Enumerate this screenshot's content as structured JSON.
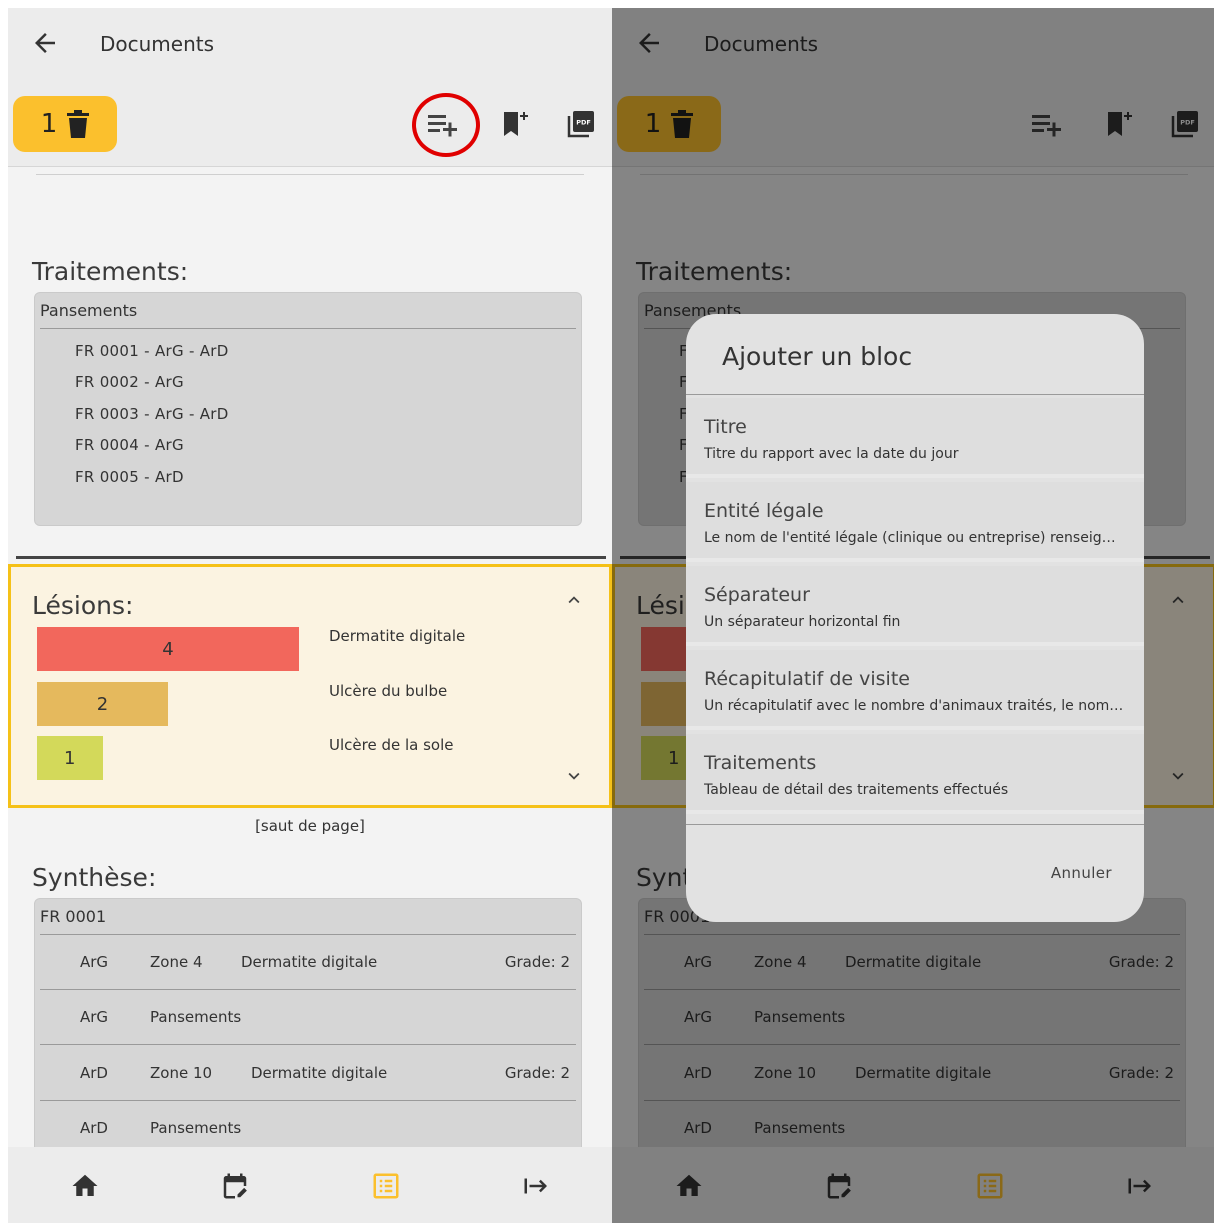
{
  "appbar": {
    "title": "Documents"
  },
  "toolbar": {
    "count": "1"
  },
  "traitements": {
    "title": "Traitements:",
    "header": "Pansements",
    "items": [
      "FR 0001 - ArG - ArD",
      "FR 0002 - ArG",
      "FR 0003 - ArG - ArD",
      "FR 0004  - ArG",
      "FR 0005 - ArD"
    ]
  },
  "lesions": {
    "title": "Lésions:"
  },
  "chart_data": {
    "type": "bar",
    "categories": [
      "Dermatite digitale",
      "Ulcère du bulbe",
      "Ulcère de la sole"
    ],
    "values": [
      4,
      2,
      1
    ],
    "colors": [
      "#f2675c",
      "#e5b95d",
      "#d3d95a"
    ]
  },
  "page_break": "[saut de page]",
  "synthese": {
    "title": "Synthèse:",
    "header": "FR 0001",
    "rows": [
      {
        "leg": "ArG",
        "zone": "Zone 4",
        "lesion": "Dermatite digitale",
        "grade": "Grade: 2"
      },
      {
        "leg": "ArG",
        "zone": "Pansements",
        "lesion": "",
        "grade": ""
      },
      {
        "leg": "ArD",
        "zone": "Zone 10",
        "lesion": "Dermatite digitale",
        "grade": "Grade: 2"
      },
      {
        "leg": "ArD",
        "zone": "Pansements",
        "lesion": "",
        "grade": ""
      }
    ]
  },
  "dialog": {
    "title": "Ajouter un bloc",
    "options": [
      {
        "title": "Titre",
        "desc": "Titre du rapport avec la date du jour"
      },
      {
        "title": "Entité légale",
        "desc": "Le nom de l'entité légale (clinique ou entreprise) renseignée"
      },
      {
        "title": "Séparateur",
        "desc": "Un séparateur horizontal fin"
      },
      {
        "title": "Récapitulatif de visite",
        "desc": "Un récapitulatif avec le nombre d'animaux traités, le nombre de lésions"
      },
      {
        "title": "Traitements",
        "desc": "Tableau de détail des traitements effectués"
      }
    ],
    "cancel": "Annuler"
  },
  "colors": {
    "accent": "#fbc02d",
    "highlight_ring": "#e00000",
    "selected_nav": "#fbc02d"
  }
}
